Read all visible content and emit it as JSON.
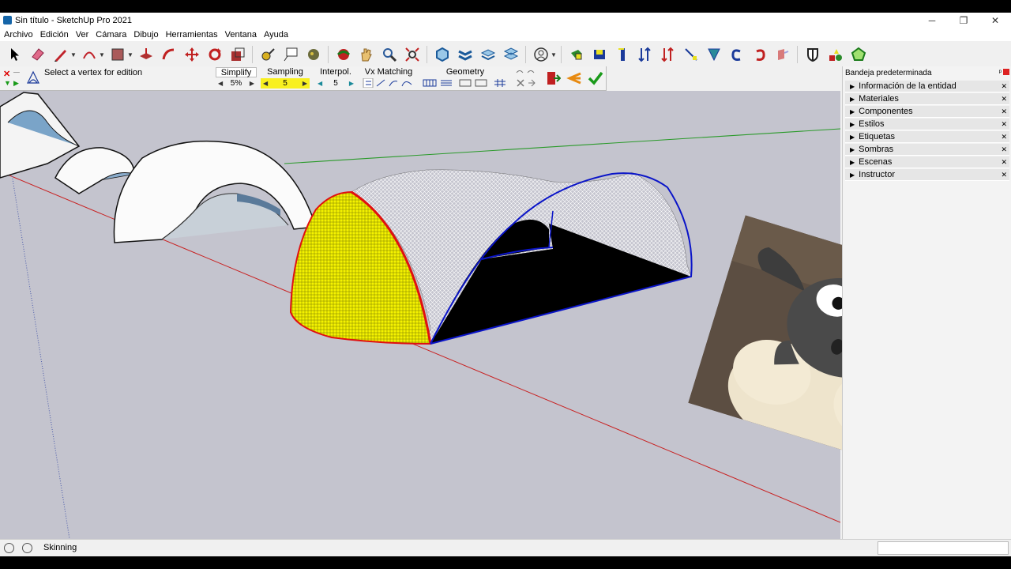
{
  "window": {
    "title": "Sin título - SketchUp Pro 2021",
    "minimize_glyph": "─",
    "restore_glyph": "❐",
    "close_glyph": "✕"
  },
  "menu": [
    "Archivo",
    "Edición",
    "Ver",
    "Cámara",
    "Dibujo",
    "Herramientas",
    "Ventana",
    "Ayuda"
  ],
  "toolbar": {
    "icons": [
      "select-icon",
      "eraser-icon",
      "pencil-line-icon",
      "arc-icon",
      "rectangle-icon",
      "push-pull-icon",
      "follow-me-icon",
      "move-icon",
      "rotate-icon",
      "scale-icon",
      "tape-measure-icon",
      "text-icon",
      "paint-bucket-icon",
      "orbit-icon",
      "pan-icon",
      "zoom-icon",
      "zoom-extents-icon",
      "outer-shell-icon",
      "intersect-icon",
      "union-icon",
      "subtract-icon",
      "user-icon",
      "extension-1-icon",
      "extension-2-icon",
      "extension-3-icon",
      "extension-4-icon",
      "extension-5-icon",
      "extension-6-icon",
      "extension-7-icon",
      "extension-8-icon",
      "extension-9-icon",
      "extension-10-icon",
      "extension-11-icon",
      "extension-12-icon"
    ]
  },
  "plugin": {
    "message": "Select a vertex for edition",
    "params": [
      {
        "label": "Simplify",
        "value": "5%"
      },
      {
        "label": "Sampling",
        "value": "5"
      },
      {
        "label": "Interpol.",
        "value": "5"
      },
      {
        "label": "Vx Matching",
        "value": ""
      },
      {
        "label": "Geometry",
        "value": ""
      }
    ]
  },
  "tray": {
    "title": "Bandeja predeterminada",
    "panels": [
      "Información de la entidad",
      "Materiales",
      "Componentes",
      "Estilos",
      "Etiquetas",
      "Sombras",
      "Escenas",
      "Instructor"
    ]
  },
  "status": {
    "text": "Skinning"
  },
  "colors": {
    "viewport_bg": "#c4c4ce",
    "axis_red": "#c82020",
    "axis_green": "#2a9a2a",
    "surface_yellow": "#f4f200",
    "edge_blue": "#0a14c8",
    "edge_red": "#e01010"
  }
}
